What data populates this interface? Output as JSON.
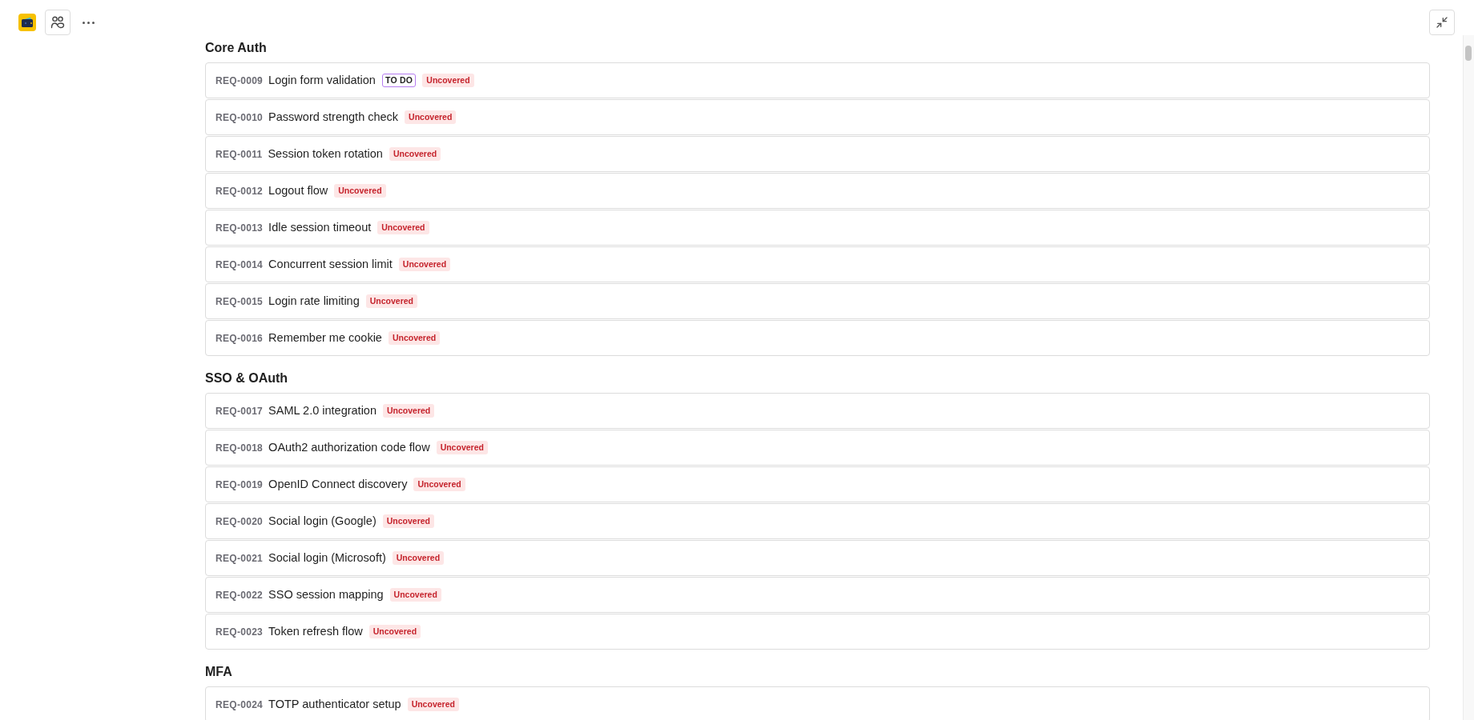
{
  "sections": [
    {
      "title": "Core Auth",
      "requirements": [
        {
          "id": "REQ-0009",
          "title": "Login form validation",
          "tags": [
            {
              "kind": "status",
              "label": "TO DO"
            },
            {
              "kind": "coverage",
              "label": "Uncovered"
            }
          ]
        },
        {
          "id": "REQ-0010",
          "title": "Password strength check",
          "tags": [
            {
              "kind": "coverage",
              "label": "Uncovered"
            }
          ]
        },
        {
          "id": "REQ-0011",
          "title": "Session token rotation",
          "tags": [
            {
              "kind": "coverage",
              "label": "Uncovered"
            }
          ]
        },
        {
          "id": "REQ-0012",
          "title": "Logout flow",
          "tags": [
            {
              "kind": "coverage",
              "label": "Uncovered"
            }
          ]
        },
        {
          "id": "REQ-0013",
          "title": "Idle session timeout",
          "tags": [
            {
              "kind": "coverage",
              "label": "Uncovered"
            }
          ]
        },
        {
          "id": "REQ-0014",
          "title": "Concurrent session limit",
          "tags": [
            {
              "kind": "coverage",
              "label": "Uncovered"
            }
          ]
        },
        {
          "id": "REQ-0015",
          "title": "Login rate limiting",
          "tags": [
            {
              "kind": "coverage",
              "label": "Uncovered"
            }
          ]
        },
        {
          "id": "REQ-0016",
          "title": "Remember me cookie",
          "tags": [
            {
              "kind": "coverage",
              "label": "Uncovered"
            }
          ]
        }
      ]
    },
    {
      "title": "SSO & OAuth",
      "requirements": [
        {
          "id": "REQ-0017",
          "title": "SAML 2.0 integration",
          "tags": [
            {
              "kind": "coverage",
              "label": "Uncovered"
            }
          ]
        },
        {
          "id": "REQ-0018",
          "title": "OAuth2 authorization code flow",
          "tags": [
            {
              "kind": "coverage",
              "label": "Uncovered"
            }
          ]
        },
        {
          "id": "REQ-0019",
          "title": "OpenID Connect discovery",
          "tags": [
            {
              "kind": "coverage",
              "label": "Uncovered"
            }
          ]
        },
        {
          "id": "REQ-0020",
          "title": "Social login (Google)",
          "tags": [
            {
              "kind": "coverage",
              "label": "Uncovered"
            }
          ]
        },
        {
          "id": "REQ-0021",
          "title": "Social login (Microsoft)",
          "tags": [
            {
              "kind": "coverage",
              "label": "Uncovered"
            }
          ]
        },
        {
          "id": "REQ-0022",
          "title": "SSO session mapping",
          "tags": [
            {
              "kind": "coverage",
              "label": "Uncovered"
            }
          ]
        },
        {
          "id": "REQ-0023",
          "title": "Token refresh flow",
          "tags": [
            {
              "kind": "coverage",
              "label": "Uncovered"
            }
          ]
        }
      ]
    },
    {
      "title": "MFA",
      "requirements": [
        {
          "id": "REQ-0024",
          "title": "TOTP authenticator setup",
          "tags": [
            {
              "kind": "coverage",
              "label": "Uncovered"
            }
          ]
        }
      ]
    }
  ]
}
